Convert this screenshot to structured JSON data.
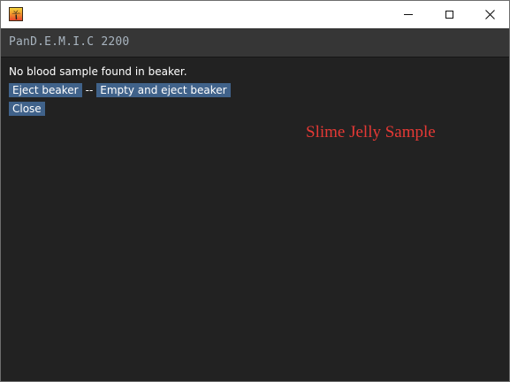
{
  "window": {
    "close_glyph": "✕",
    "icons": {
      "app": "palm-tree-icon",
      "minimize": "minimize-icon",
      "maximize": "maximize-icon",
      "close": "close-icon"
    }
  },
  "header": {
    "title": "PanD.E.M.I.C 2200"
  },
  "content": {
    "status": "No blood sample found in beaker.",
    "eject_label": "Eject beaker",
    "separator": "--",
    "empty_eject_label": "Empty and eject beaker",
    "close_label": "Close"
  },
  "overlay": {
    "label": "Slime Jelly Sample"
  },
  "colors": {
    "background": "#222222",
    "header_bg": "#363636",
    "button_bg": "#40628a",
    "header_text": "#a8b4bf",
    "overlay_text": "#e53935"
  }
}
